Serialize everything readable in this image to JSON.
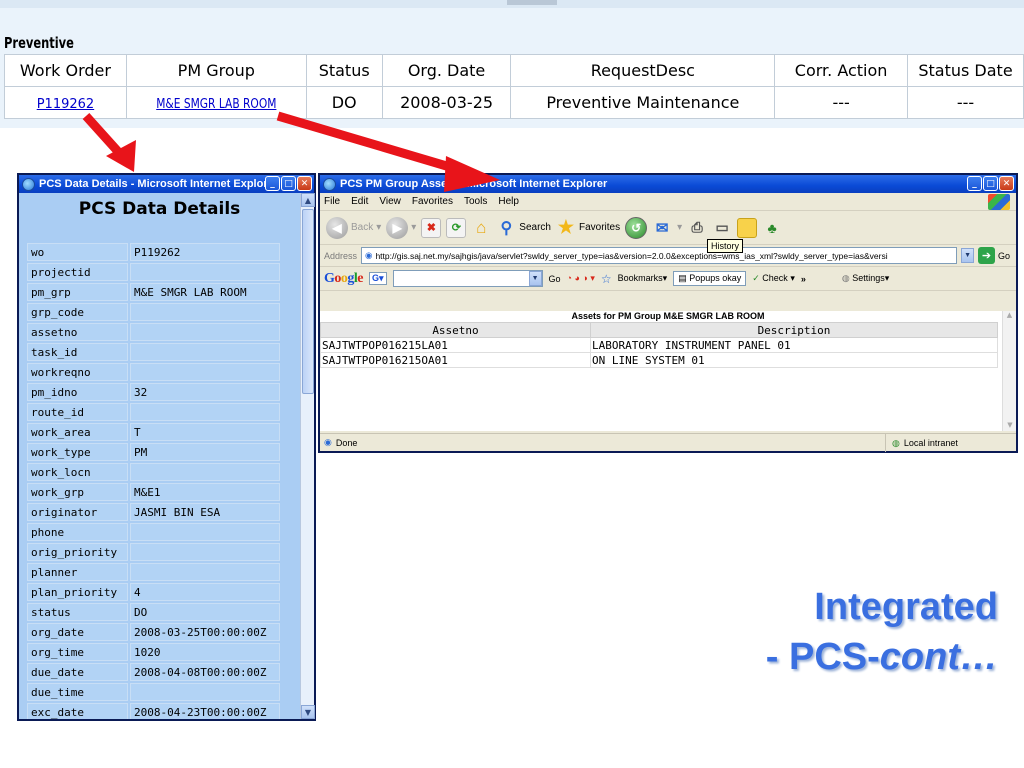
{
  "preventive": {
    "title": "Preventive",
    "columns": [
      "Work Order",
      "PM Group",
      "Status",
      "Org. Date",
      "RequestDesc",
      "Corr. Action",
      "Status Date"
    ],
    "row": {
      "work_order": "P119262",
      "pm_group": "M&E SMGR LAB ROOM",
      "status": "DO",
      "org_date": "2008-03-25",
      "request_desc": "Preventive Maintenance",
      "corr_action": "---",
      "status_date": "---"
    }
  },
  "pcs_window": {
    "title": "PCS Data Details - Microsoft Internet Explorer",
    "heading": "PCS Data Details",
    "fields": [
      {
        "key": "wo",
        "value": "P119262"
      },
      {
        "key": "projectid",
        "value": ""
      },
      {
        "key": "pm_grp",
        "value": "M&E SMGR LAB ROOM"
      },
      {
        "key": "grp_code",
        "value": ""
      },
      {
        "key": "assetno",
        "value": ""
      },
      {
        "key": "task_id",
        "value": ""
      },
      {
        "key": "workreqno",
        "value": ""
      },
      {
        "key": "pm_idno",
        "value": "32"
      },
      {
        "key": "route_id",
        "value": ""
      },
      {
        "key": "work_area",
        "value": "T"
      },
      {
        "key": "work_type",
        "value": "PM"
      },
      {
        "key": "work_locn",
        "value": ""
      },
      {
        "key": "work_grp",
        "value": "M&E1"
      },
      {
        "key": "originator",
        "value": "JASMI BIN ESA"
      },
      {
        "key": "phone",
        "value": ""
      },
      {
        "key": "orig_priority",
        "value": ""
      },
      {
        "key": "planner",
        "value": ""
      },
      {
        "key": "plan_priority",
        "value": "4"
      },
      {
        "key": "status",
        "value": "DO"
      },
      {
        "key": "org_date",
        "value": "2008-03-25T00:00:00Z"
      },
      {
        "key": "org_time",
        "value": "1020"
      },
      {
        "key": "due_date",
        "value": "2008-04-08T00:00:00Z"
      },
      {
        "key": "due_time",
        "value": ""
      },
      {
        "key": "exc_date",
        "value": "2008-04-23T00:00:00Z"
      }
    ]
  },
  "pm_window": {
    "title": "PCS PM Group Assets - Microsoft Internet Explorer",
    "menu": [
      "File",
      "Edit",
      "View",
      "Favorites",
      "Tools",
      "Help"
    ],
    "toolbar": {
      "back": "Back",
      "search": "Search",
      "favorites": "Favorites",
      "history_tooltip": "History"
    },
    "address": {
      "label": "Address",
      "url": "http://gis.saj.net.my/sajhgis/java/servlet?swldy_server_type=ias&version=2.0.0&exceptions=wms_ias_xml?swldy_server_type=ias&versi",
      "go": "Go"
    },
    "google_bar": {
      "go": "Go",
      "bookmarks": "Bookmarks",
      "popups": "Popups okay",
      "check": "Check",
      "settings": "Settings"
    },
    "assets": {
      "caption": "Assets for PM Group M&E SMGR LAB ROOM",
      "columns": [
        "Assetno",
        "Description"
      ],
      "rows": [
        {
          "assetno": "SAJTWTPOP016215LA01",
          "description": "LABORATORY INSTRUMENT PANEL 01"
        },
        {
          "assetno": "SAJTWTPOP016215OA01",
          "description": "ON LINE SYSTEM 01"
        }
      ]
    },
    "status": {
      "text": "Done",
      "zone": "Local intranet"
    }
  },
  "headline": {
    "line1": "Integrated",
    "line2_prefix": "- PCS-",
    "line2_italic": "cont…"
  },
  "colors": {
    "arrow": "#e8141a",
    "headline": "#3a6fe0",
    "pcs_body": "#aacdf3",
    "link": "#0000cc"
  }
}
